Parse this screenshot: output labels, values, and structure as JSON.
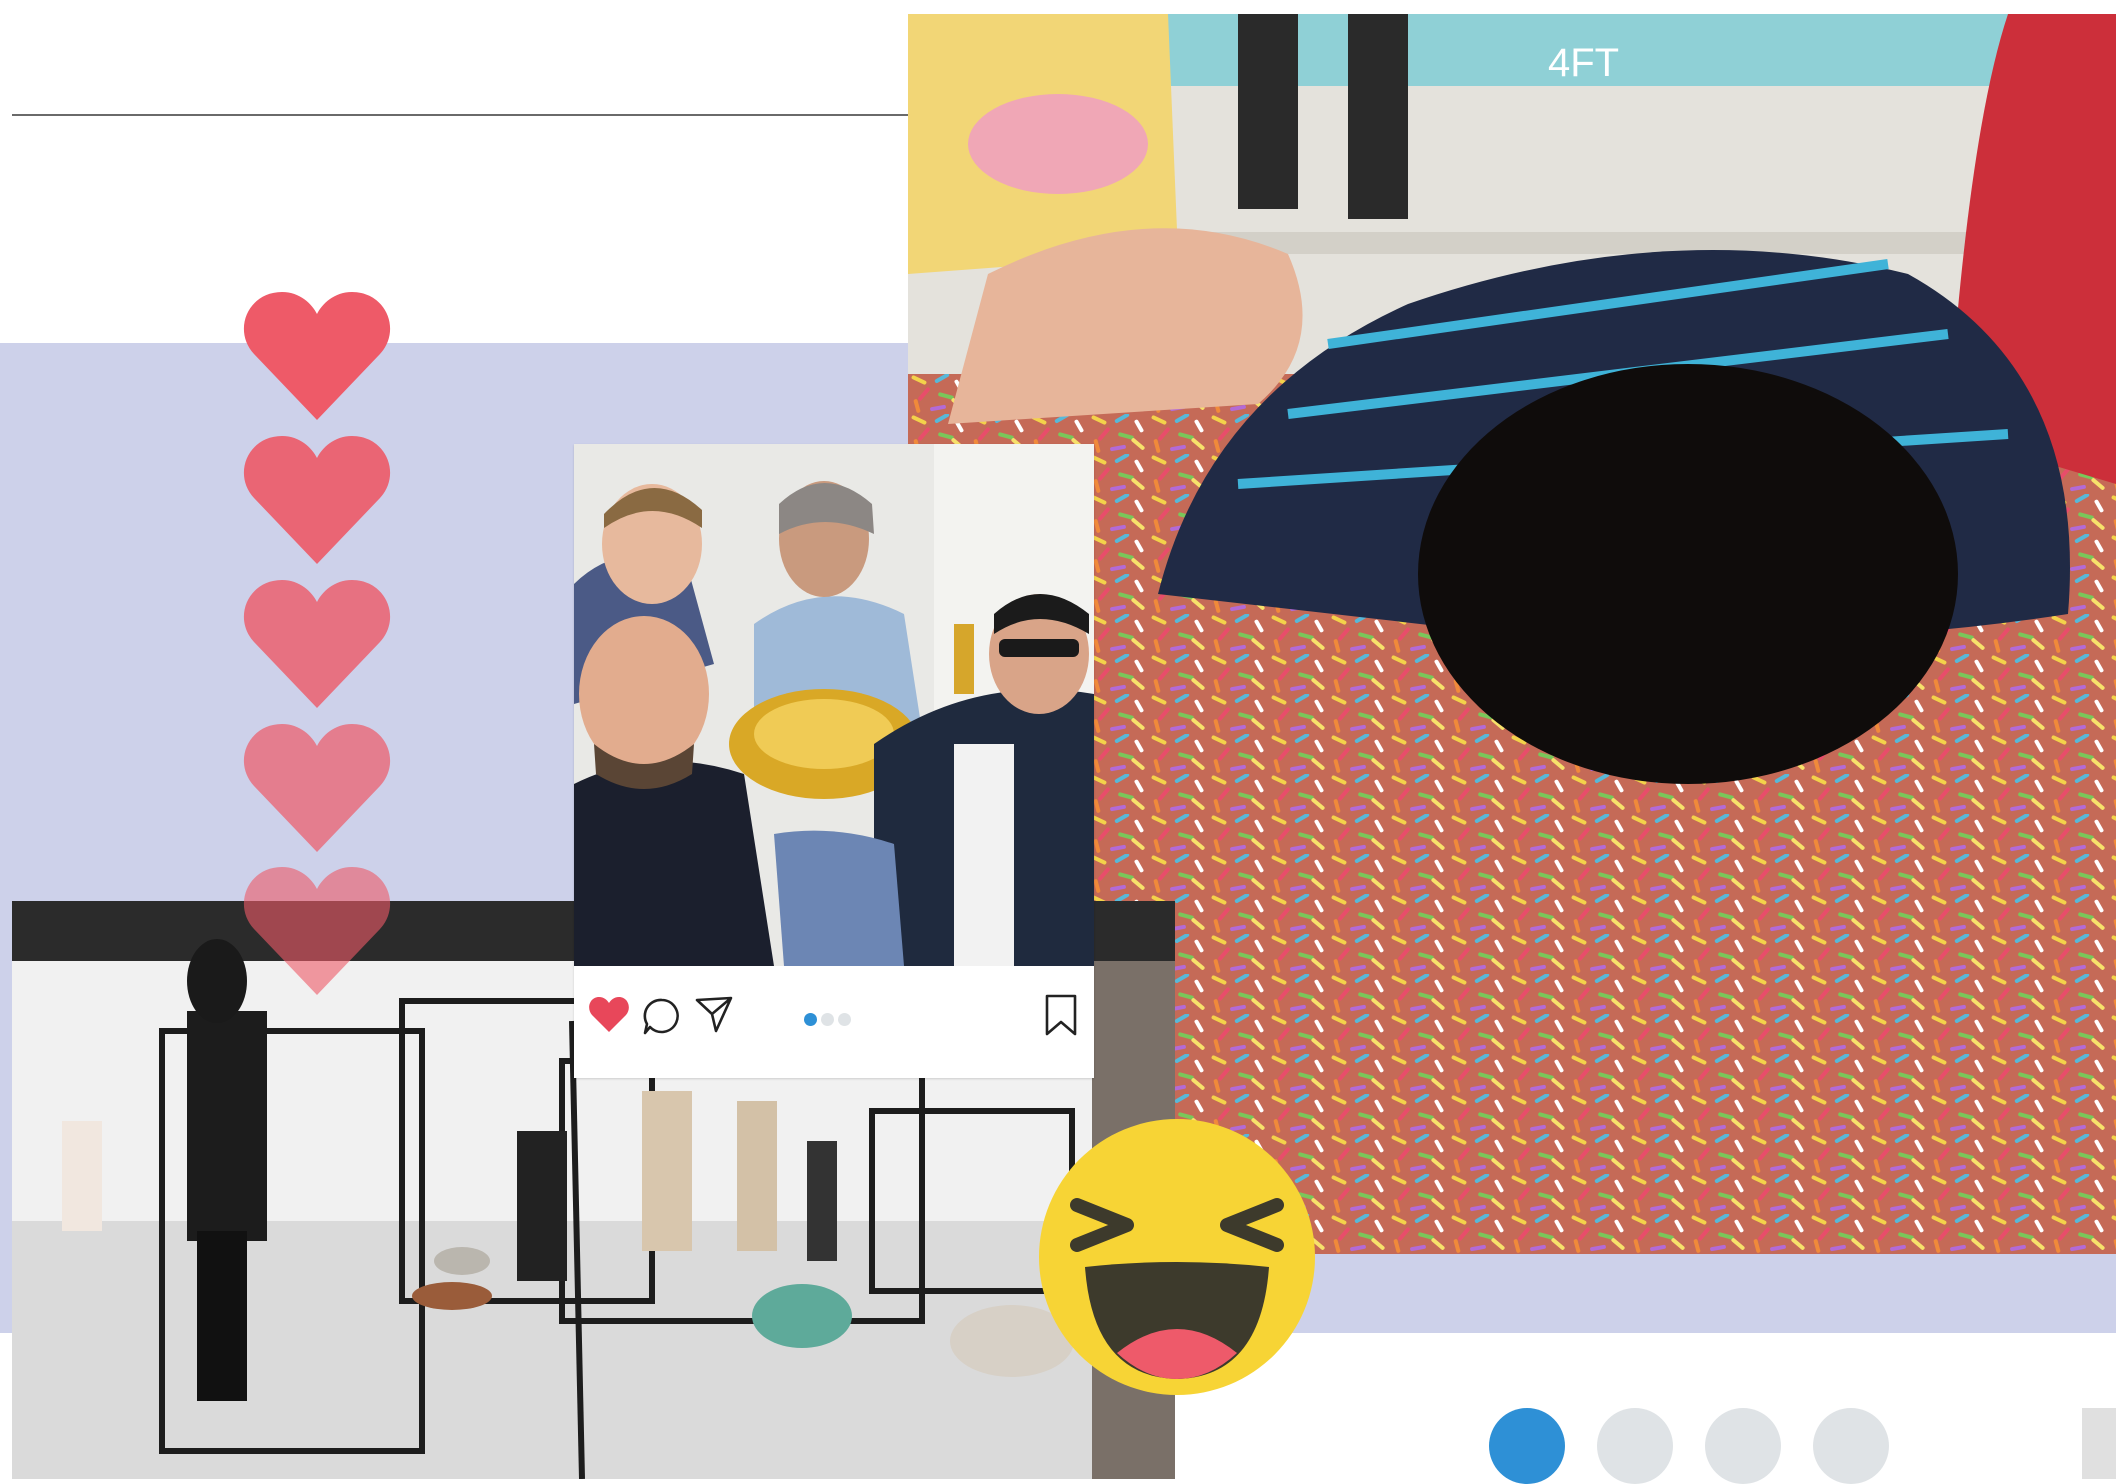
{
  "colors": {
    "lavender": "#cdd1ea",
    "heart_red": "#ee5a68",
    "dot_active": "#2e90d6",
    "dot_inactive": "#dfe3e6",
    "emoji_yellow": "#f7d435",
    "emoji_mouth": "#3d3a2c",
    "emoji_tongue": "#ee5a6a"
  },
  "photos": {
    "sprinkles": {
      "subject": "child-lying-in-sprinkle-pool"
    },
    "gallery": {
      "subject": "visitors-in-gallery-with-frames-and-stones"
    },
    "instagram": {
      "subject": "group-with-golden-toilet"
    }
  },
  "instagram_card": {
    "icons": [
      "heart-icon",
      "comment-icon",
      "share-icon",
      "bookmark-icon"
    ],
    "liked": true,
    "carousel": {
      "count": 3,
      "active_index": 0
    }
  },
  "hearts": {
    "count": 5,
    "opacity_levels": [
      1.0,
      0.9,
      0.8,
      0.7,
      0.6
    ]
  },
  "pagination": {
    "count": 4,
    "active_index": 0
  },
  "wall_sign": {
    "text": "4FT"
  }
}
